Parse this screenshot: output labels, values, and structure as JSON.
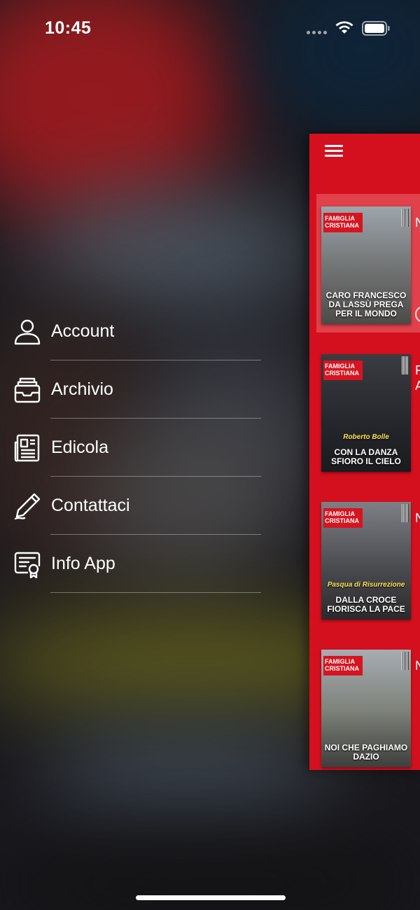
{
  "status_bar": {
    "time": "10:45"
  },
  "menu": {
    "items": [
      {
        "label": "Account",
        "icon": "person-icon"
      },
      {
        "label": "Archivio",
        "icon": "archive-tray-icon"
      },
      {
        "label": "Edicola",
        "icon": "newspaper-icon"
      },
      {
        "label": "Contattaci",
        "icon": "pencil-icon"
      },
      {
        "label": "Info App",
        "icon": "certificate-icon"
      }
    ]
  },
  "panel": {
    "accent": "#d5101e",
    "issues": [
      {
        "masthead": "FAMIGLIA CRISTIANA",
        "kicker": "",
        "headline": "CARO FRANCESCO DA LASSÙ PREGA PER IL MONDO",
        "peek": "N",
        "selected": true
      },
      {
        "masthead": "FAMIGLIA CRISTIANA",
        "kicker": "Roberto Bolle",
        "headline": "CON LA DANZA SFIORO IL CIELO",
        "peek": "F A",
        "selected": false
      },
      {
        "masthead": "FAMIGLIA CRISTIANA",
        "kicker": "Pasqua di Risurrezione",
        "headline": "DALLA CROCE FIORISCA LA PACE",
        "peek": "N",
        "selected": false
      },
      {
        "masthead": "FAMIGLIA CRISTIANA",
        "kicker": "",
        "headline": "NOI CHE PAGHIAMO DAZIO",
        "peek": "N",
        "selected": false
      }
    ]
  }
}
